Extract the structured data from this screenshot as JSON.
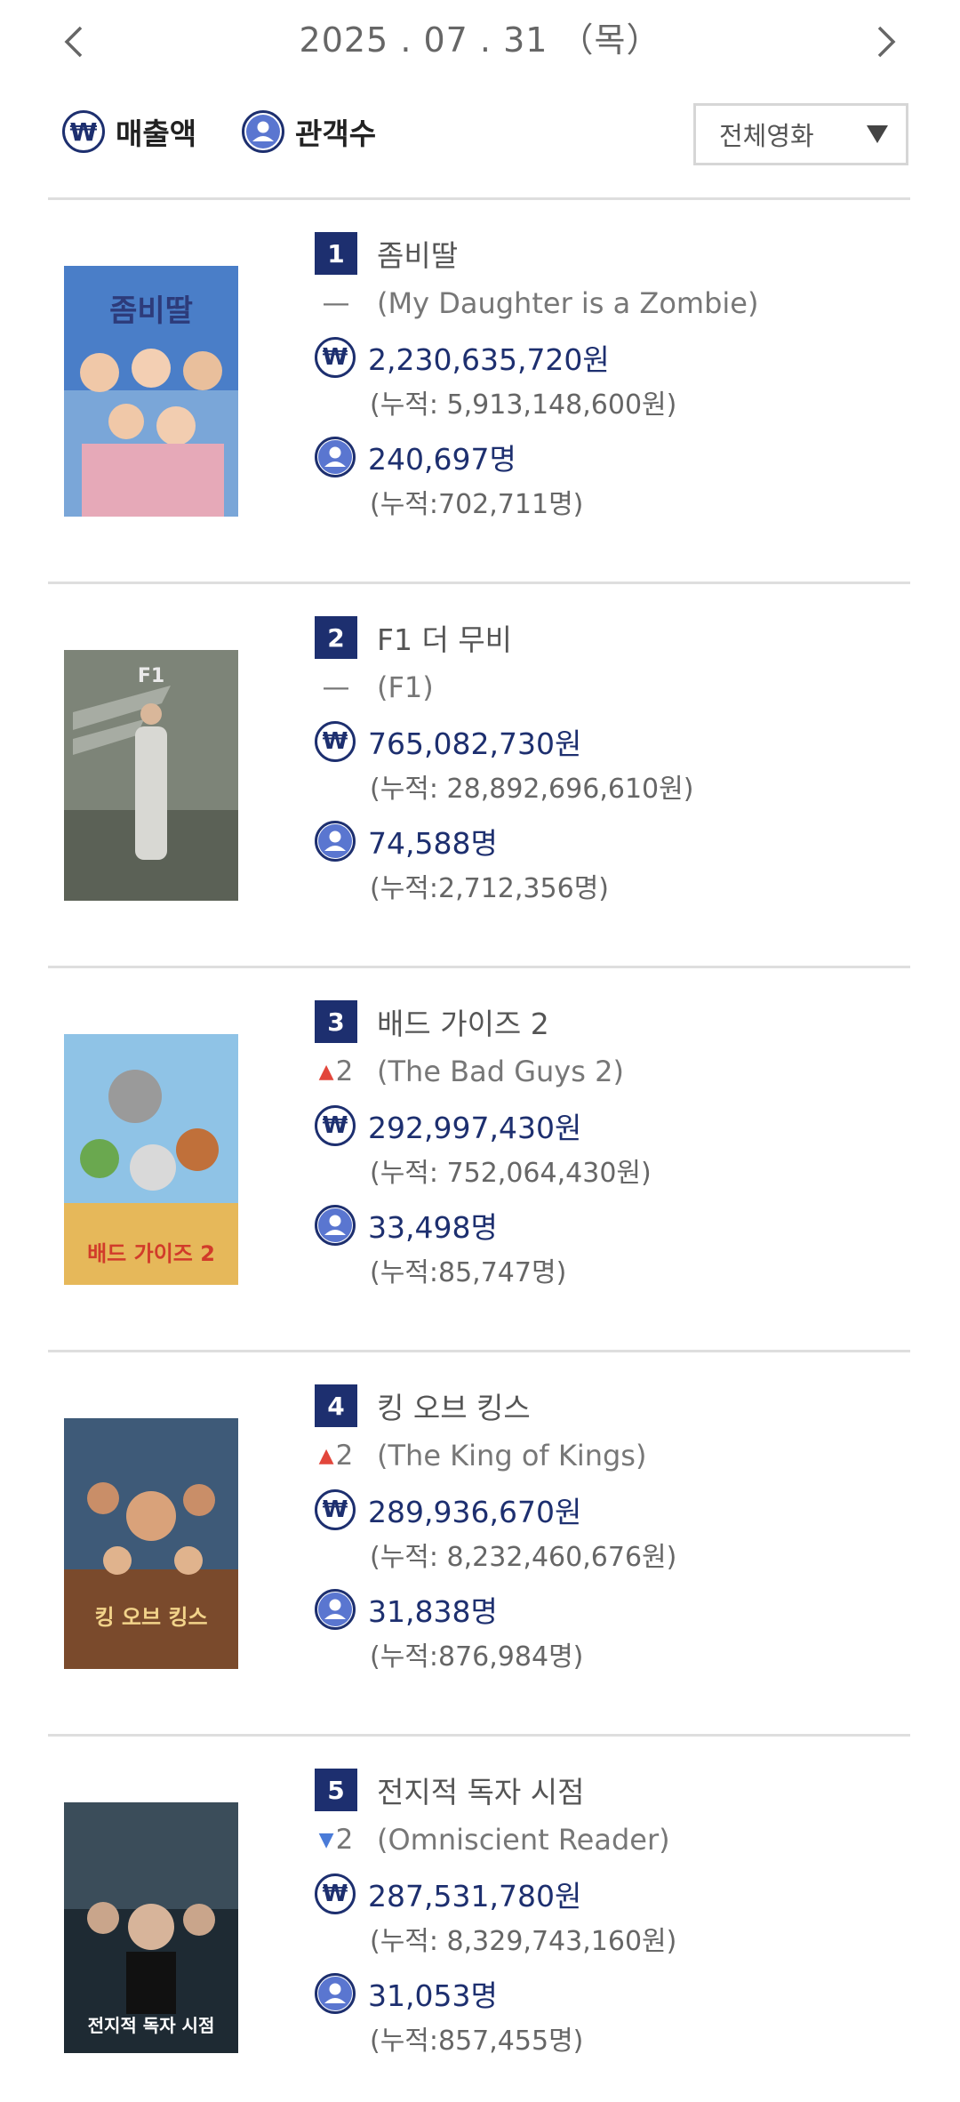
{
  "header": {
    "date": "2025 . 07 . 31 （목）"
  },
  "controls": {
    "sales_label": "매출액",
    "audience_label": "관객수",
    "sales_icon": "won-icon",
    "audience_icon": "person-icon",
    "won_symbol": "₩",
    "filter_value": "전체영화"
  },
  "colors": {
    "accent": "#1d2f6f",
    "rank_up": "#e2463b",
    "rank_down": "#4a7bd8"
  },
  "movies": [
    {
      "rank": "1",
      "title": "좀비딸",
      "change_dir": "none",
      "change": "—",
      "original_title": "(My Daughter is a Zombie)",
      "sales": "2,230,635,720원",
      "sales_cum": "(누적: 5,913,148,600원)",
      "audience": "240,697명",
      "audience_cum": "(누적:702,711명)",
      "poster_text": "좀비딸"
    },
    {
      "rank": "2",
      "title": "F1 더 무비",
      "change_dir": "none",
      "change": "—",
      "original_title": "(F1)",
      "sales": "765,082,730원",
      "sales_cum": "(누적: 28,892,696,610원)",
      "audience": "74,588명",
      "audience_cum": "(누적:2,712,356명)",
      "poster_text": "F1"
    },
    {
      "rank": "3",
      "title": "배드 가이즈 2",
      "change_dir": "up",
      "change": "2",
      "original_title": "(The Bad Guys 2)",
      "sales": "292,997,430원",
      "sales_cum": "(누적: 752,064,430원)",
      "audience": "33,498명",
      "audience_cum": "(누적:85,747명)",
      "poster_text": "배드 가이즈 2"
    },
    {
      "rank": "4",
      "title": "킹 오브 킹스",
      "change_dir": "up",
      "change": "2",
      "original_title": "(The King of Kings)",
      "sales": "289,936,670원",
      "sales_cum": "(누적: 8,232,460,676원)",
      "audience": "31,838명",
      "audience_cum": "(누적:876,984명)",
      "poster_text": "킹 오브 킹스"
    },
    {
      "rank": "5",
      "title": "전지적 독자 시점",
      "change_dir": "down",
      "change": "2",
      "original_title": "(Omniscient Reader)",
      "sales": "287,531,780원",
      "sales_cum": "(누적: 8,329,743,160원)",
      "audience": "31,053명",
      "audience_cum": "(누적:857,455명)",
      "poster_text": "전지적 독자 시점"
    }
  ]
}
